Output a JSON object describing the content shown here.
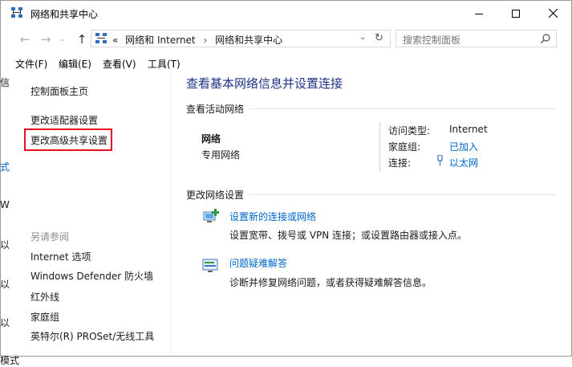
{
  "window": {
    "title": "网络和共享中心",
    "controls": {
      "minimize": "—",
      "maximize": "☐",
      "close": "✕"
    }
  },
  "address": {
    "overflow": "«",
    "crumbs": [
      "网络和 Internet",
      "网络和共享中心"
    ],
    "separator": "›"
  },
  "search": {
    "placeholder": "搜索控制面板"
  },
  "menu": [
    "文件(F)",
    "编辑(E)",
    "查看(V)",
    "工具(T)"
  ],
  "left_pane": {
    "links": [
      "控制面板主页",
      "更改适配器设置",
      "更改高级共享设置"
    ],
    "see_also_label": "另请参阅",
    "see_also": [
      "Internet 选项",
      "Windows Defender 防火墙",
      "红外线",
      "家庭组",
      "英特尔(R) PROSet/无线工具"
    ],
    "edge_chars": [
      "信",
      "式",
      "W",
      "以",
      "以",
      "以",
      "模式"
    ]
  },
  "main": {
    "heading": "查看基本网络信息并设置连接",
    "active_networks_label": "查看活动网络",
    "network": {
      "name": "网络",
      "type": "专用网络",
      "access_type_label": "访问类型:",
      "access_type_value": "Internet",
      "homegroup_label": "家庭组:",
      "homegroup_value": "已加入",
      "connection_label": "连接:",
      "connection_value": "以太网"
    },
    "change_settings_label": "更改网络设置",
    "tasks": [
      {
        "link": "设置新的连接或网络",
        "desc": "设置宽带、拨号或 VPN 连接；或设置路由器或接入点。"
      },
      {
        "link": "问题疑难解答",
        "desc": "诊断并修复网络问题，或者获得疑难解答信息。"
      }
    ]
  },
  "colors": {
    "heading": "#1e3287",
    "link": "#0066cc",
    "highlight": "#e81123"
  }
}
